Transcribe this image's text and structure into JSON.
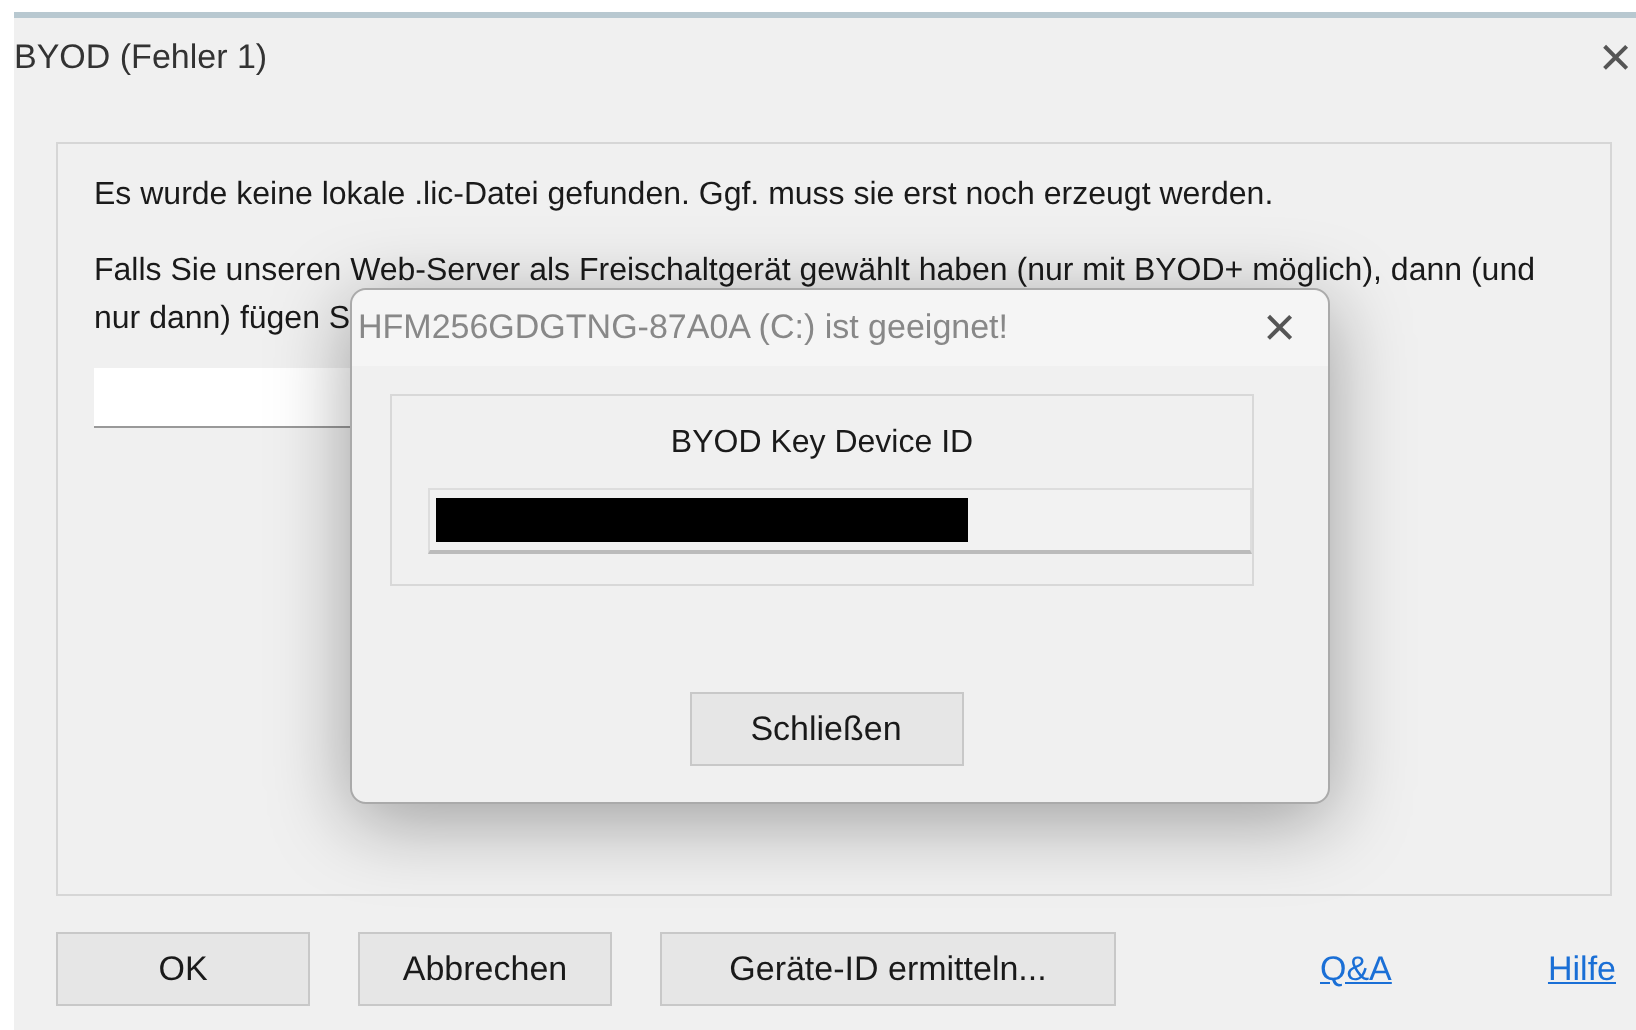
{
  "window": {
    "title": "BYOD (Fehler 1)",
    "close": "×"
  },
  "message": {
    "line_1": "Es wurde keine lokale .lic-Datei gefunden. Ggf. muss sie erst noch erzeugt werden.",
    "line_2": "Falls Sie unseren Web-Server als Freischaltgerät gewählt haben (nur mit BYOD+ möglich), dann (und",
    "line_3": "nur dann) fügen S"
  },
  "buttons": [
    {
      "label": "OK",
      "kind": "button"
    },
    {
      "label": "Abbrechen",
      "kind": "button"
    },
    {
      "label": "Geräte-ID ermitteln...",
      "kind": "button"
    },
    {
      "label": "Q&A",
      "kind": "link"
    },
    {
      "label": "Hilfe",
      "kind": "link"
    }
  ],
  "popup": {
    "title": "HFM256GDGTNG-87A0A (C:) ist geeignet!",
    "close": "×",
    "group_label": "BYOD Key Device ID",
    "button": "Schließen"
  }
}
